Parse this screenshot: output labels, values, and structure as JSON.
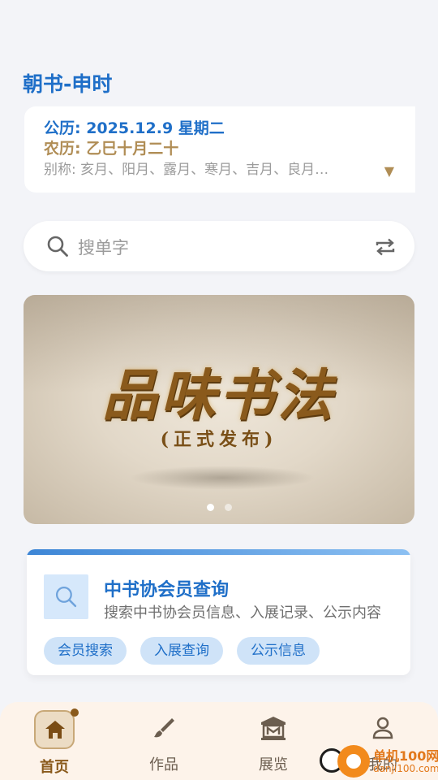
{
  "header": {
    "title": "朝书-申时"
  },
  "calendar": {
    "gregorian": "公历: 2025.12.9 星期二",
    "lunar": "农历: 乙巳十月二十",
    "alias": "别称: 亥月、阳月、露月、寒月、吉月、良月…",
    "expand_glyph": "▼"
  },
  "search": {
    "placeholder": "搜单字",
    "icon": "search-icon",
    "switch_icon": "swap-icon"
  },
  "banner": {
    "title": "品味书法",
    "subtitle": "(正式发布)",
    "slide_count": 2,
    "active_slide": 1
  },
  "member_card": {
    "title": "中书协会员查询",
    "description": "搜索中书协会员信息、入展记录、公示内容",
    "chips": [
      "会员搜索",
      "入展查询",
      "公示信息"
    ]
  },
  "bottom_nav": {
    "items": [
      {
        "label": "首页",
        "icon": "home-icon",
        "active": true
      },
      {
        "label": "作品",
        "icon": "brush-icon",
        "active": false
      },
      {
        "label": "展览",
        "icon": "museum-icon",
        "active": false
      },
      {
        "label": "我的",
        "icon": "user-icon",
        "active": false
      }
    ]
  },
  "watermark": {
    "name": "单机100网",
    "url": "danji100.com"
  },
  "colors": {
    "accent_blue": "#1f6fc8",
    "accent_gold": "#b08d55",
    "nav_background": "#fdf3ea",
    "page_background": "#f3f4f8"
  }
}
